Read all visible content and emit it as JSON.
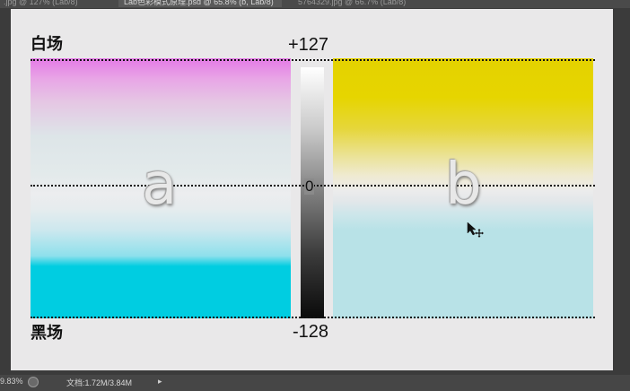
{
  "tabs": [
    {
      "label": ".jpg @ 127% (Lab/8)"
    },
    {
      "label": "Lab色彩模式原理.psd @ 65.8% (b, Lab/8)"
    },
    {
      "label": "5764329.jpg @ 66.7% (Lab/8)"
    }
  ],
  "canvas": {
    "white_field_label": "白场",
    "black_field_label": "黑场",
    "top_value": "+127",
    "bottom_value": "-128",
    "center_value": "0",
    "channel_a_label": "a",
    "channel_b_label": "b"
  },
  "status_bar": {
    "zoom": "9.83%",
    "doc_info": "文档:1.72M/3.84M",
    "arrow": "▸"
  },
  "colors": {
    "magenta": "#e47ae6",
    "cyan": "#00cde1",
    "yellow": "#e4d200",
    "light_blue": "#b8e2e7"
  },
  "icons": [
    "status-indicator-icon",
    "cursor-move-icon"
  ]
}
